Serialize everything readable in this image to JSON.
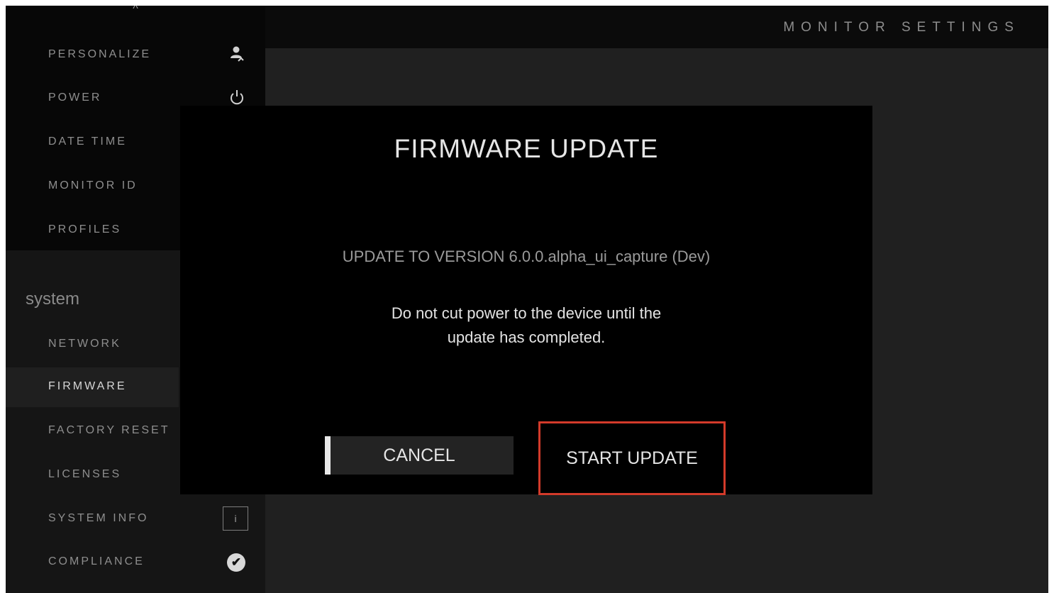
{
  "header": {
    "title": "MONITOR SETTINGS"
  },
  "sidebar": {
    "scroll_up": "^",
    "items_top": [
      {
        "label": "PERSONALIZE",
        "icon": "person-icon"
      },
      {
        "label": "POWER",
        "icon": "power-icon"
      },
      {
        "label": "DATE TIME"
      },
      {
        "label": "MONITOR ID"
      },
      {
        "label": "PROFILES"
      }
    ],
    "section": "system",
    "items_system": [
      {
        "label": "NETWORK"
      },
      {
        "label": "FIRMWARE",
        "selected": true
      },
      {
        "label": "FACTORY RESET"
      },
      {
        "label": "LICENSES"
      },
      {
        "label": "SYSTEM INFO",
        "icon": "info-icon",
        "icon_text": "i"
      },
      {
        "label": "COMPLIANCE",
        "icon": "check-icon",
        "icon_text": "✔"
      }
    ]
  },
  "modal": {
    "title": "FIRMWARE UPDATE",
    "version_text": "UPDATE TO VERSION 6.0.0.alpha_ui_capture (Dev)",
    "warning_line1": "Do not cut power to the device until the",
    "warning_line2": "update has completed.",
    "cancel_label": "CANCEL",
    "start_label": "START UPDATE"
  },
  "colors": {
    "highlight_border": "#d33a2a",
    "background": "#202020",
    "modal": "#000000"
  }
}
